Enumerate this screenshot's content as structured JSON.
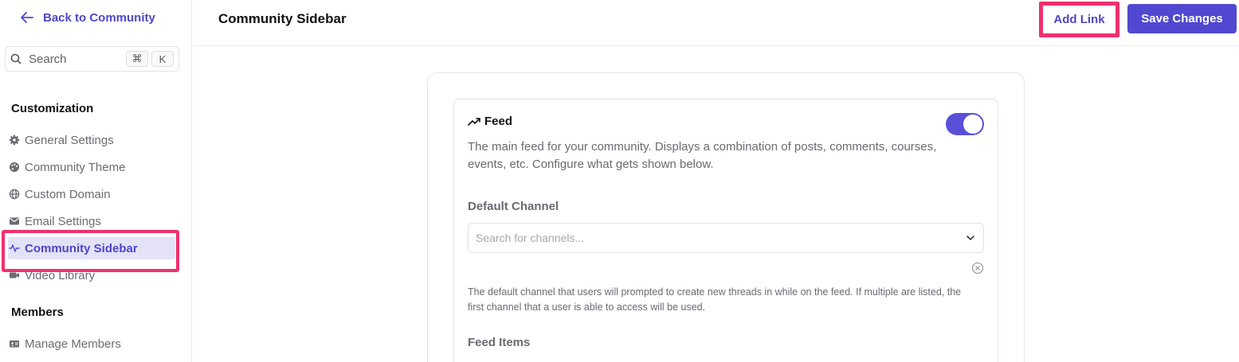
{
  "sidebar": {
    "back_label": "Back to Community",
    "search": {
      "label": "Search",
      "kbd1": "⌘",
      "kbd2": "K"
    },
    "sections": [
      {
        "title": "Customization"
      },
      {
        "title": "Members"
      }
    ],
    "items": [
      {
        "label": "General Settings",
        "icon": "gear-icon"
      },
      {
        "label": "Community Theme",
        "icon": "palette-icon"
      },
      {
        "label": "Custom Domain",
        "icon": "globe-icon"
      },
      {
        "label": "Email Settings",
        "icon": "mail-icon"
      },
      {
        "label": "Community Sidebar",
        "icon": "activity-icon",
        "active": true
      },
      {
        "label": "Video Library",
        "icon": "video-icon"
      },
      {
        "label": "Manage Members",
        "icon": "id-card-icon"
      }
    ]
  },
  "header": {
    "title": "Community Sidebar",
    "add_link_label": "Add Link",
    "save_label": "Save Changes"
  },
  "feed": {
    "title": "Feed",
    "icon": "trending-up-icon",
    "enabled": true,
    "description": "The main feed for your community. Displays a combination of posts, comments, courses, events, etc. Configure what gets shown below.",
    "default_channel_label": "Default Channel",
    "channel_placeholder": "Search for channels...",
    "help_text": "The default channel that users will prompted to create new threads in while on the feed. If multiple are listed, the first channel that a user is able to access will be used.",
    "feed_items_label": "Feed Items"
  },
  "colors": {
    "accent": "#5048d0",
    "highlight": "#f0306e",
    "active_bg": "#e3e2f7"
  }
}
